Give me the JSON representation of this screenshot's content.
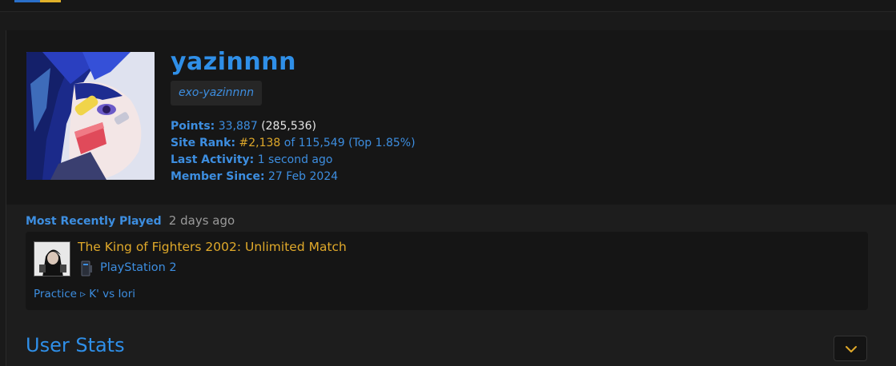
{
  "colors": {
    "link": "#3d8ee0",
    "username": "#2f8fe8",
    "highlight": "#e0a92a",
    "value_text": "#e6e6e6",
    "muted": "#9a9a9a"
  },
  "profile": {
    "username": "yazinnnn",
    "motto": "exo-yazinnnn",
    "points_label": "Points:",
    "points": "33,887",
    "points_retro": "(285,536)",
    "rank_label": "Site Rank:",
    "rank": "#2,138",
    "rank_of": "of 115,549",
    "rank_top": "(Top 1.85%)",
    "last_activity_label": "Last Activity:",
    "last_activity": "1 second ago",
    "member_since_label": "Member Since:",
    "member_since": "27 Feb 2024"
  },
  "recently_played": {
    "title": "Most Recently Played",
    "when": "2 days ago",
    "game_title": "The King of Fighters 2002: Unlimited Match",
    "console": "PlayStation 2",
    "console_icon": "playstation-2-icon",
    "rich_presence": "Practice ▹ K' vs Iori"
  },
  "user_stats": {
    "title": "User Stats",
    "expand_icon": "chevron-down-icon"
  }
}
